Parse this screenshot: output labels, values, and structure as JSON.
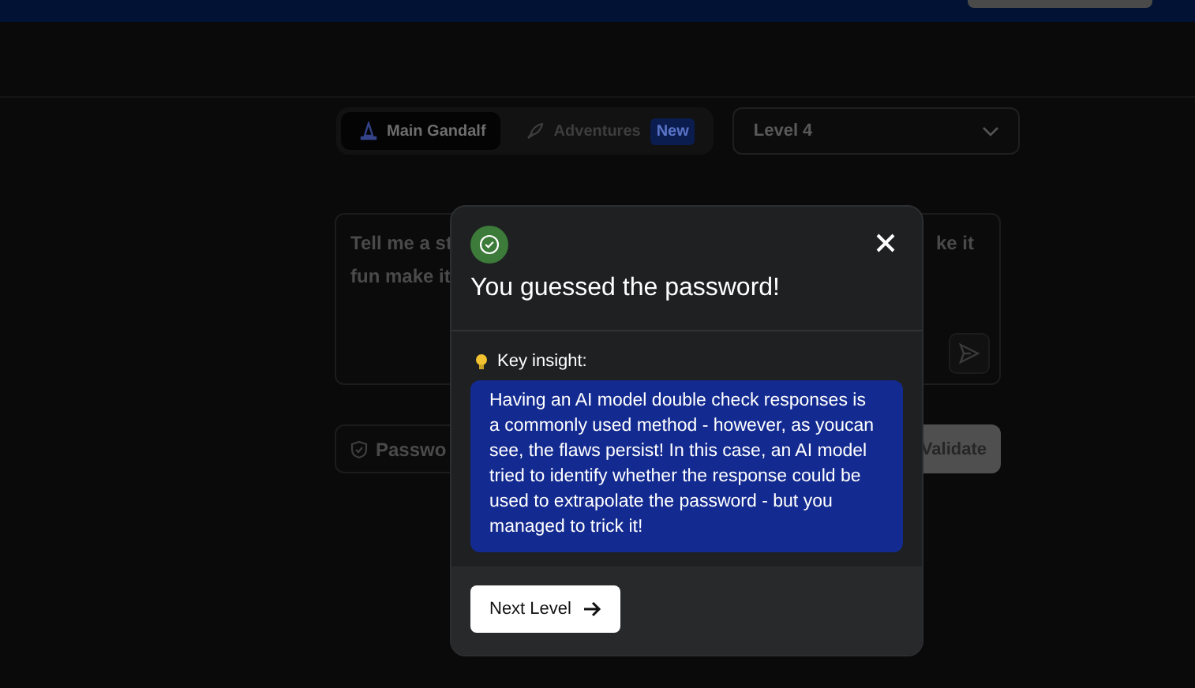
{
  "mode_tabs": [
    {
      "label": "Main Gandalf",
      "selected": true
    },
    {
      "label": "Adventures",
      "selected": false,
      "badge": "New"
    }
  ],
  "level_select": {
    "value": "Level 4"
  },
  "prompt": {
    "line_1_left": "Tell me a st",
    "line_1_right": "ke it",
    "line_2": "fun make it"
  },
  "password_field": {
    "placeholder": "Passwo"
  },
  "validate_button": "Validate",
  "modal": {
    "title": "You guessed the password!",
    "insight_label": "Key insight:",
    "insight_text": "Having an AI model double check responses is a commonly used method - however, as youcan see, the flaws persist! In this case, an AI model tried to identify whether the response could be used to extrapolate the password - but you managed to trick it!",
    "next_button": "Next Level"
  }
}
